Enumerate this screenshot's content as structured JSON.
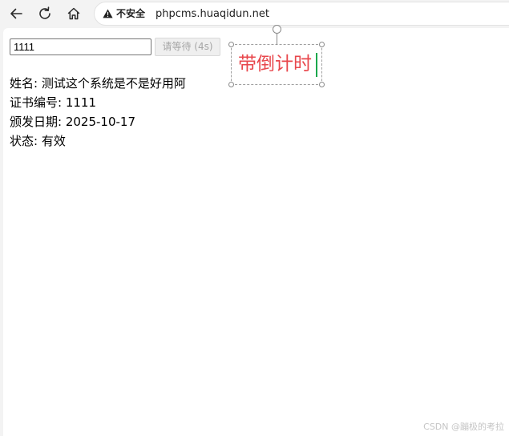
{
  "browser": {
    "security_label": "不安全",
    "url": "phpcms.huaqidun.net"
  },
  "form": {
    "input_value": "1111",
    "wait_button_label": "请等待 (4s)"
  },
  "result": {
    "name_line": "姓名: 测试这个系统是不是好用阿",
    "cert_no_line": "证书编号: 1111",
    "issue_date_line": "颁发日期: 2025-10-17",
    "status_line": "状态: 有效"
  },
  "annotation": {
    "text": "带倒计时",
    "color": "#e8474c"
  },
  "watermark": {
    "text": "CSDN @蹦极的考拉"
  },
  "icons": [
    "back-arrow-icon",
    "reload-icon",
    "home-icon",
    "warning-icon"
  ]
}
